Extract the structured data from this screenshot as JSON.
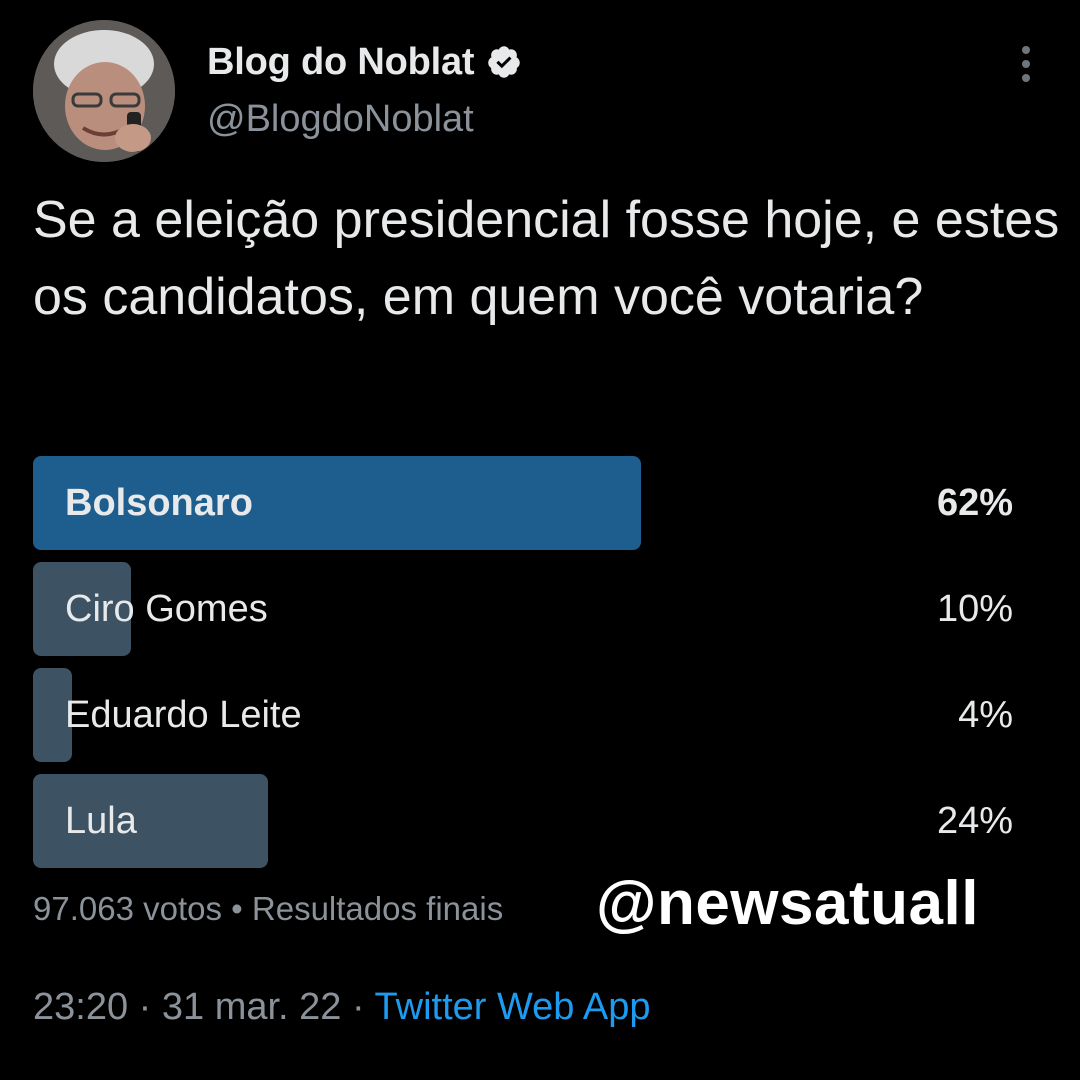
{
  "header": {
    "display_name": "Blog do Noblat",
    "handle": "@BlogdoNoblat",
    "verified_icon": "verified-badge-icon",
    "more_icon": "more-vertical-icon"
  },
  "tweet": {
    "text": "Se a eleição presidencial fosse hoje, e estes os candidatos, em quem você votaria?"
  },
  "poll": {
    "options": [
      {
        "label": "Bolsonaro",
        "percent_text": "62%",
        "percent": 62,
        "winner": true
      },
      {
        "label": "Ciro Gomes",
        "percent_text": "10%",
        "percent": 10,
        "winner": false
      },
      {
        "label": "Eduardo Leite",
        "percent_text": "4%",
        "percent": 4,
        "winner": false
      },
      {
        "label": "Lula",
        "percent_text": "24%",
        "percent": 24,
        "winner": false
      }
    ],
    "votes": "97.063 votos",
    "separator": "•",
    "status": "Resultados finais"
  },
  "watermark": "@newsatuall",
  "footer": {
    "time": "23:20",
    "separator": "·",
    "date": "31 mar. 22",
    "source": "Twitter Web App"
  },
  "colors": {
    "background": "#000000",
    "winner_bar": "#1d5e8f",
    "bar": "#3d5263",
    "link": "#1d9bf0",
    "secondary_text": "#8b9299"
  }
}
